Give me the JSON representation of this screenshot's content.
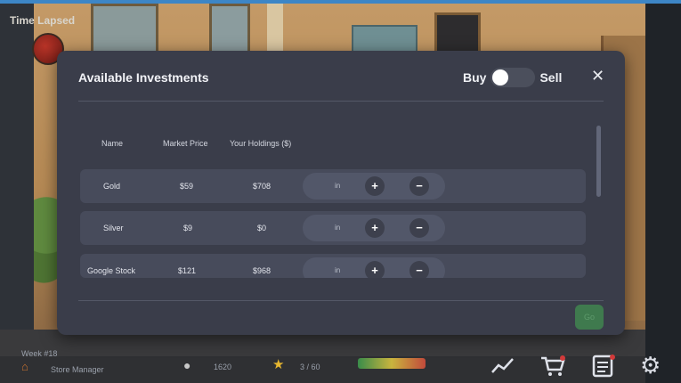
{
  "hud": {
    "time_label": "Time Lapsed",
    "week_label": "Week #18",
    "role_label": "Store Manager",
    "coins": "1620",
    "rating": "3 / 60",
    "icons": [
      "chart-icon",
      "cart-icon",
      "list-icon",
      "gear-icon"
    ]
  },
  "modal": {
    "title": "Available Investments",
    "toggle": {
      "left": "Buy",
      "right": "Sell",
      "state": "Buy"
    },
    "close_glyph": "✕",
    "confirm_label": "Go",
    "columns": [
      "Name",
      "Market Price",
      "Your Holdings ($)"
    ],
    "rows": [
      {
        "name": "Gold",
        "price": "$59",
        "holdings": "$708",
        "amount": "in",
        "plus": "+",
        "minus": "−"
      },
      {
        "name": "Silver",
        "price": "$9",
        "holdings": "$0",
        "amount": "in",
        "plus": "+",
        "minus": "−"
      },
      {
        "name": "Google Stock",
        "price": "$121",
        "holdings": "$968",
        "amount": "in",
        "plus": "+",
        "minus": "−"
      }
    ]
  },
  "colors": {
    "modal_bg": "#3a3d4a",
    "row_bg": "#474b5b",
    "confirm_green": "#3f7a4e",
    "top_frame": "#3d86c6"
  }
}
